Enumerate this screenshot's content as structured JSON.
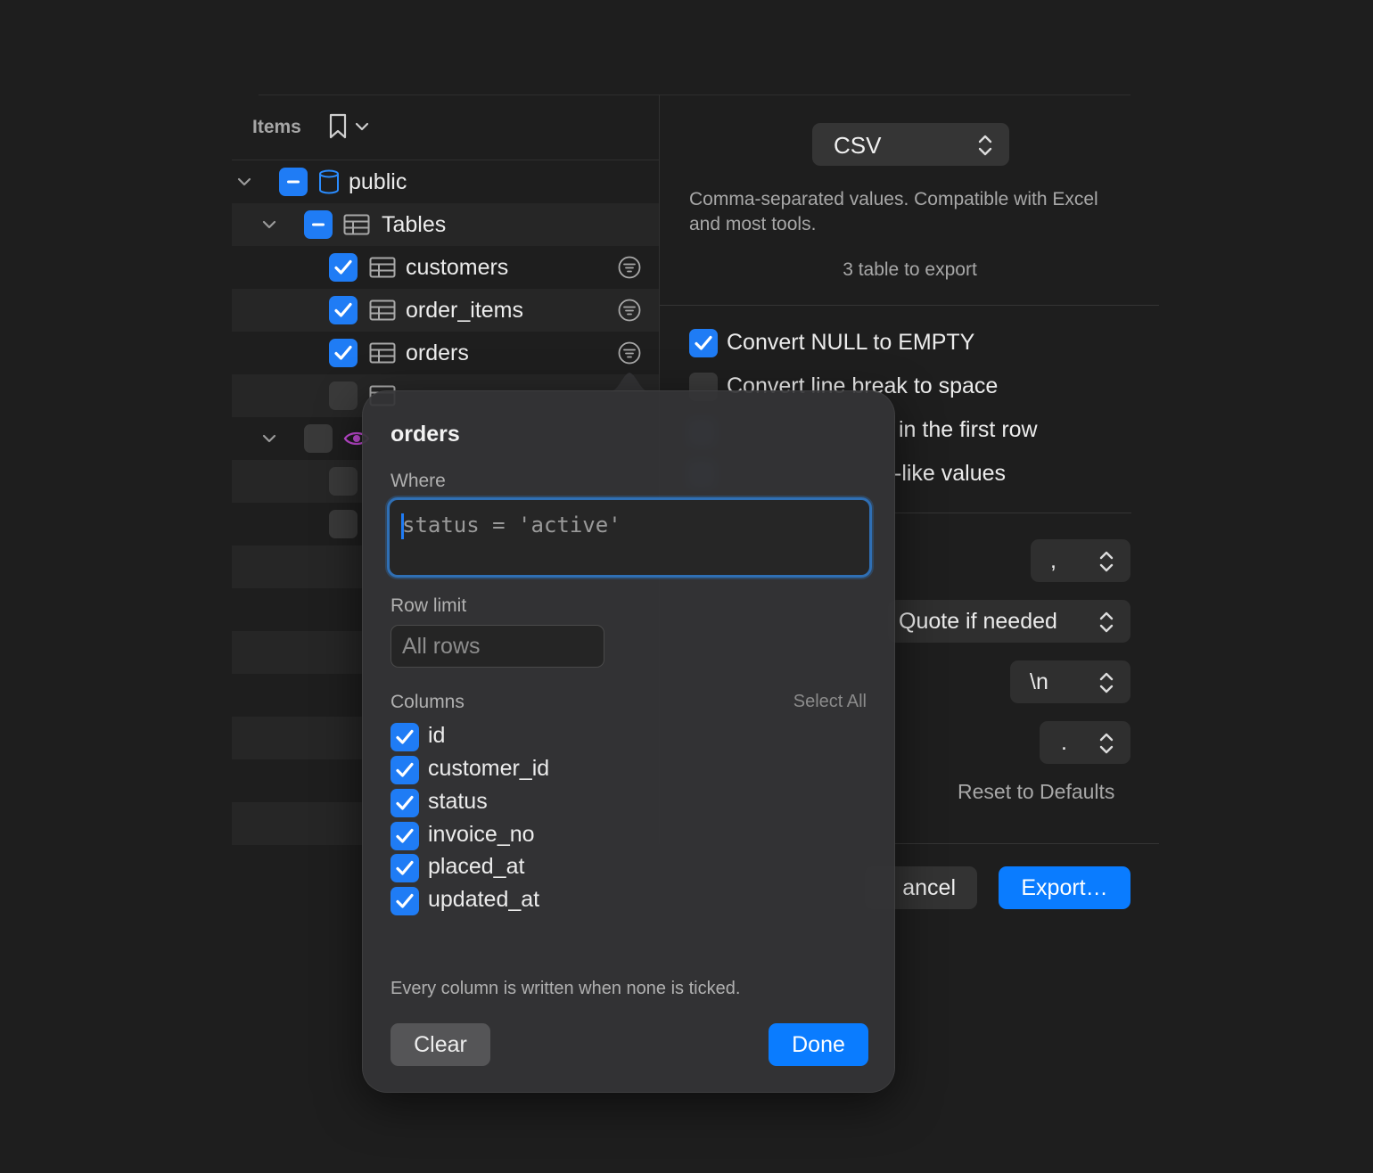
{
  "sidebar": {
    "title": "Items",
    "tree": {
      "schema": "public",
      "tables_group": "Tables",
      "tables": [
        "customers",
        "order_items",
        "orders"
      ]
    }
  },
  "format": {
    "selected": "CSV",
    "description": "Comma-separated values. Compatible with Excel and most tools.",
    "export_count": "3 table to export"
  },
  "options": {
    "convert_null": "Convert NULL to EMPTY",
    "convert_linebreak": "Convert line break to space",
    "first_row_partial": "in the first row",
    "values_partial": "-like values"
  },
  "selects": {
    "delimiter": ",",
    "quote": "Quote if needed",
    "line_break": "\\n",
    "decimal": "."
  },
  "reset_label": "Reset to Defaults",
  "footer": {
    "cancel_partial": "ancel",
    "export": "Export…"
  },
  "popover": {
    "title": "orders",
    "where_label": "Where",
    "where_value": "status = 'active'",
    "row_limit_label": "Row limit",
    "row_limit_placeholder": "All rows",
    "columns_label": "Columns",
    "select_all": "Select All",
    "columns": [
      "id",
      "customer_id",
      "status",
      "invoice_no",
      "placed_at",
      "updated_at"
    ],
    "note": "Every column is written when none is ticked.",
    "clear": "Clear",
    "done": "Done"
  },
  "colors": {
    "accent": "#0a7cff",
    "background": "#1e1e1e",
    "popover": "#343436",
    "view_icon": "#c34bd6"
  }
}
